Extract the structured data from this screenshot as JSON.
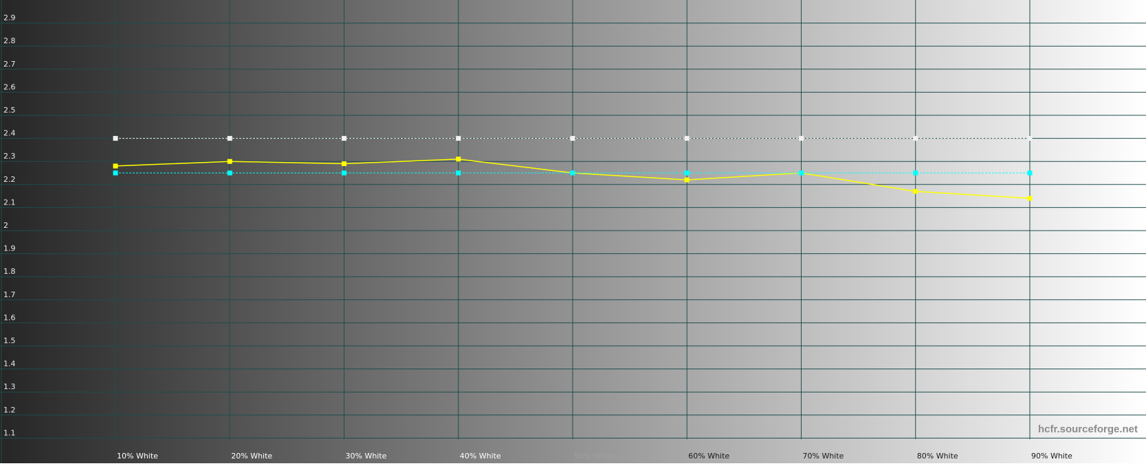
{
  "chart_data": {
    "type": "line",
    "categories": [
      "10% White",
      "20% White",
      "30% White",
      "40% White",
      "50% White",
      "60% White",
      "70% White",
      "80% White",
      "90% White"
    ],
    "series": [
      {
        "values": [
          2.28,
          2.3,
          2.29,
          2.31,
          2.25,
          2.22,
          2.25,
          2.17,
          2.14
        ],
        "color": "#ffff00",
        "style": "solid",
        "markers": true
      },
      {
        "values": [
          2.4,
          2.4,
          2.4,
          2.4,
          2.4,
          2.4,
          2.4,
          2.4,
          2.4
        ],
        "color": "#f0f0f0",
        "style": "dashed",
        "markers": true
      },
      {
        "values": [
          2.25,
          2.25,
          2.25,
          2.25,
          2.25,
          2.25,
          2.25,
          2.25,
          2.25
        ],
        "color": "#00ffff",
        "style": "dashed",
        "markers": true
      }
    ],
    "yticks": [
      "1.1",
      "1.2",
      "1.3",
      "1.4",
      "1.5",
      "1.6",
      "1.7",
      "1.8",
      "1.9",
      "2",
      "2.1",
      "2.2",
      "2.3",
      "2.4",
      "2.5",
      "2.6",
      "2.7",
      "2.8",
      "2.9"
    ],
    "ylim": [
      1.0,
      3.0
    ],
    "grid": true,
    "background": "grayscale-gradient-dark-to-light",
    "grid_color": "#1f4d4d",
    "watermark": "hcfr.sourceforge.net"
  }
}
